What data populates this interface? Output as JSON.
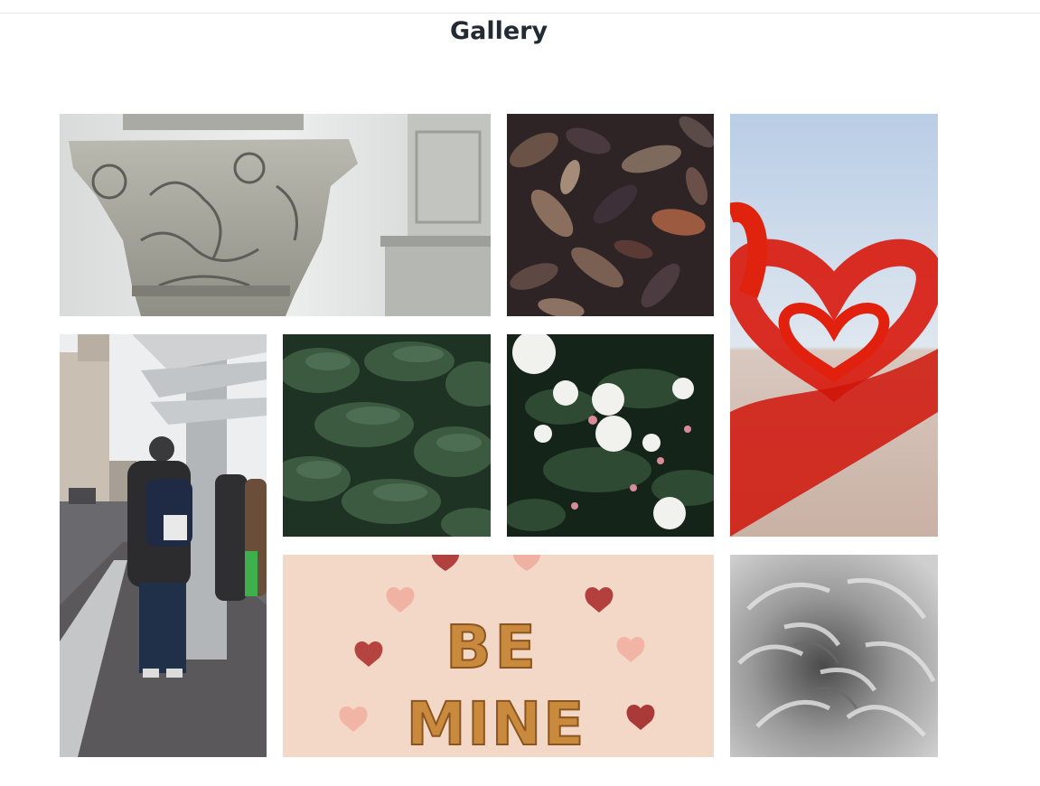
{
  "page": {
    "title": "Gallery"
  },
  "gallery": {
    "images": [
      {
        "subject": "ornate-column-capital"
      },
      {
        "subject": "dry-autumn-leaves"
      },
      {
        "subject": "red-heart-petals"
      },
      {
        "subject": "street-bus-stop-man"
      },
      {
        "subject": "green-conifer-foliage"
      },
      {
        "subject": "white-roses"
      },
      {
        "subject": "heart-cookies",
        "cookie_text_line1": "BE",
        "cookie_text_line2": "MINE"
      },
      {
        "subject": "grayscale-chrysanthemum"
      }
    ]
  },
  "colors": {
    "title": "#222a33",
    "rule": "#e3e3e3"
  }
}
